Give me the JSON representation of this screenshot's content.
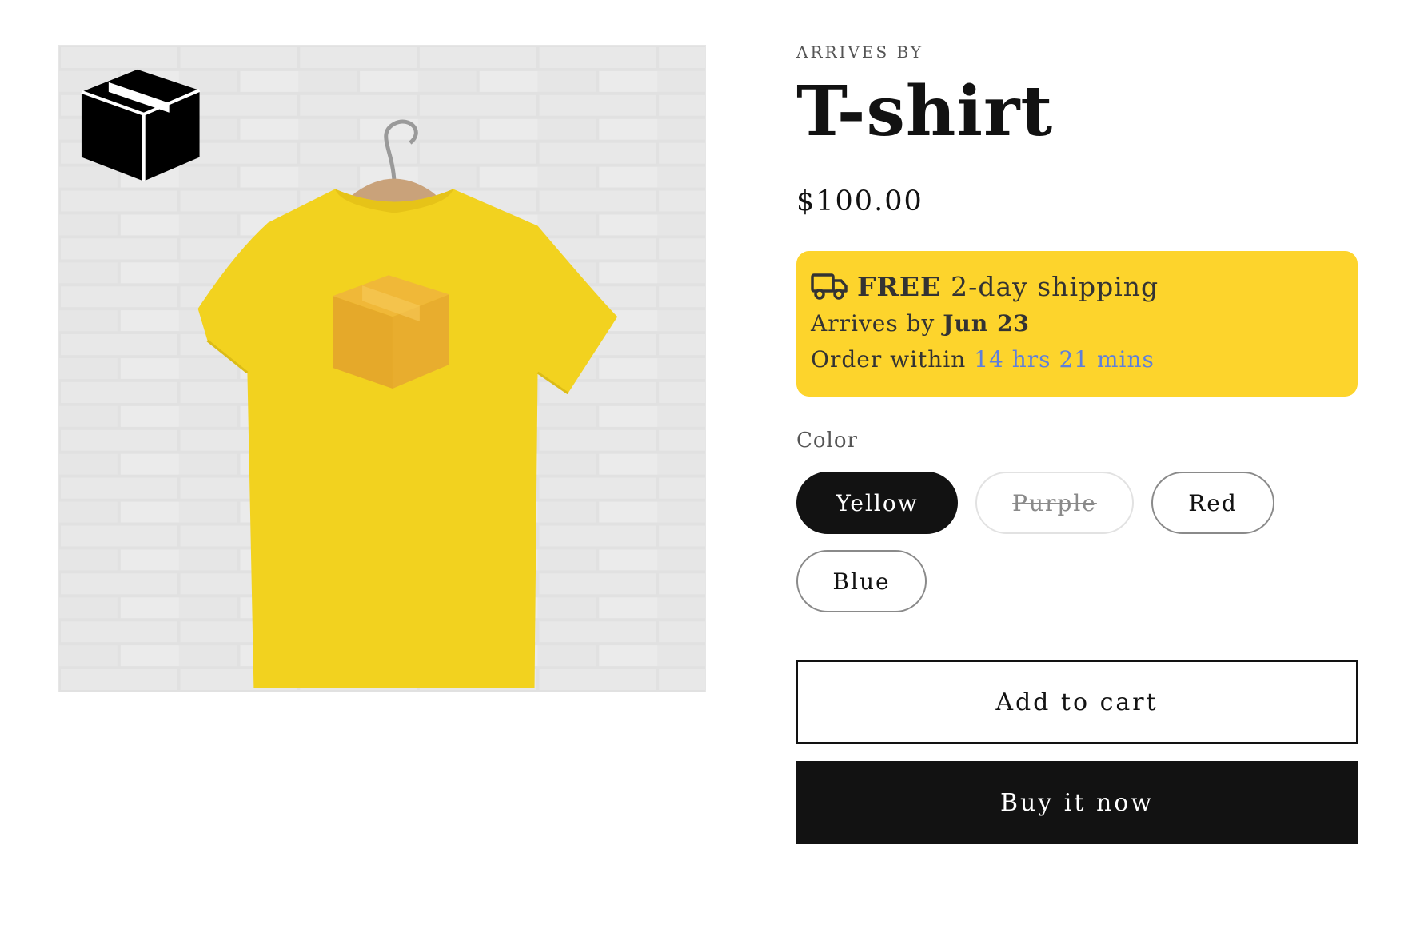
{
  "product": {
    "image_alt": "Yellow T-shirt with box graphic on hanger",
    "image_logo_text": "Arrives By",
    "vendor": "ARRIVES BY",
    "title": "T-shirt",
    "price": "$100.00"
  },
  "shipping": {
    "background": "#fdd42c",
    "icon": "truck-icon",
    "free_label": "FREE",
    "speed_label": "2-day shipping",
    "arrives_prefix": "Arrives by",
    "arrives_date": "Jun 23",
    "order_prefix": "Order within",
    "countdown": "14 hrs 21 mins",
    "countdown_color": "#5d7fdc"
  },
  "variants": {
    "label": "Color",
    "options": [
      {
        "label": "Yellow",
        "state": "selected"
      },
      {
        "label": "Purple",
        "state": "unavailable"
      },
      {
        "label": "Red",
        "state": "available"
      },
      {
        "label": "Blue",
        "state": "available"
      }
    ]
  },
  "buttons": {
    "add_to_cart": "Add to cart",
    "buy_now": "Buy it now"
  },
  "colors": {
    "text": "#121212",
    "shirt": "#f2d21f",
    "box_graphic": "#e5a92a"
  }
}
